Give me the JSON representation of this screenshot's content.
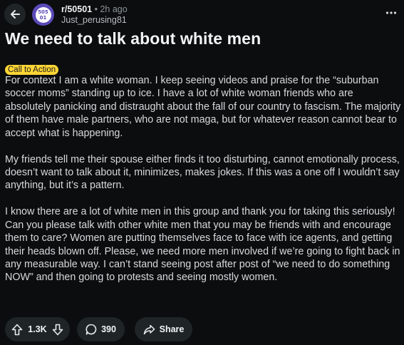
{
  "header": {
    "subreddit": "r/50501",
    "separator": "•",
    "age": "2h ago",
    "author": "Just_perusing81",
    "avatar_text_top": "505",
    "avatar_text_bottom": "01"
  },
  "post": {
    "title": "We need to talk about white men",
    "flair": "Call to Action",
    "flair_color": "#ffd635",
    "paragraphs": [
      "For context I am a white woman. I keep seeing videos and praise for the “suburban soccer moms” standing up to ice. I have a lot of white woman friends who are absolutely panicking and distraught about the fall of our country to fascism. The majority of them have male partners, who are not maga, but for whatever reason cannot bear to accept what is happening.",
      "My friends tell me their spouse either finds it too disturbing, cannot emotionally process, doesn’t want to talk about it, minimizes, makes jokes. If this was a one off I wouldn’t say anything, but it’s a pattern.",
      "I know there are a lot of white men in this group and thank you for taking this seriously! Can you please talk with other white men that you may be friends with and encourage them to care? Women are putting themselves face to face with ice agents, and getting their heads blown off. Please, we need more men involved if we’re going to fight back in any measurable way. I can’t stand seeing post after post of “we need to do something NOW” and then going to protests and seeing mostly women."
    ]
  },
  "actions": {
    "vote_count": "1.3K",
    "comment_count": "390",
    "share_label": "Share"
  },
  "icons": {
    "back": "arrow-left-icon",
    "more": "more-horizontal-icon",
    "upvote": "arrow-up-icon",
    "downvote": "arrow-down-icon",
    "comment": "comment-bubble-icon",
    "share": "share-arrow-icon"
  },
  "colors": {
    "background": "#0b0d0e",
    "pill": "#1f2527",
    "avatar": "#5b4ab8"
  }
}
